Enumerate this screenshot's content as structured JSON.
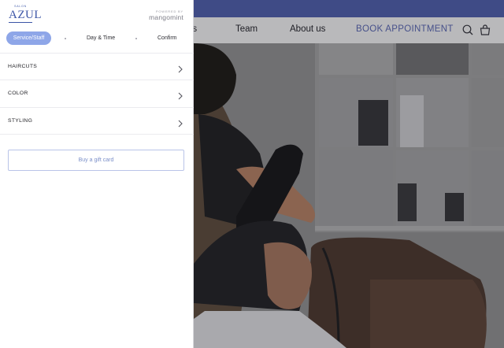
{
  "site": {
    "nav": {
      "services_partial": "es",
      "team": "Team",
      "about": "About us",
      "book": "BOOK APPOINTMENT"
    },
    "icons": {
      "search": "search-icon",
      "bag": "shopping-bag-icon"
    }
  },
  "panel": {
    "brand": {
      "tagline": "SALON",
      "name": "AZUL"
    },
    "powered": {
      "label": "POWERED BY",
      "name": "mangomint"
    },
    "steps": [
      {
        "label": "Service/Staff",
        "active": true
      },
      {
        "label": "Day & Time",
        "active": false
      },
      {
        "label": "Confirm",
        "active": false
      }
    ],
    "categories": [
      {
        "label": "HAIRCUTS"
      },
      {
        "label": "COLOR"
      },
      {
        "label": "STYLING"
      }
    ],
    "gift_card": "Buy a gift card"
  },
  "colors": {
    "accent": "#8ea6e8",
    "brand": "#3b55a6",
    "site_topbar": "#3f4b86"
  }
}
